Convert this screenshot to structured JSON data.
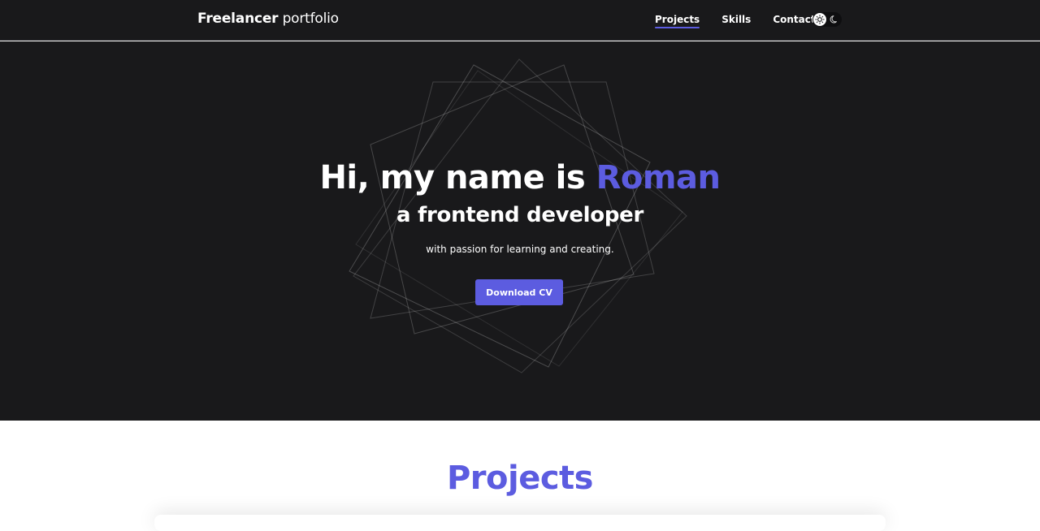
{
  "header": {
    "logo_bold": "Freelancer",
    "logo_light": " portfolio",
    "nav": [
      {
        "label": "Projects",
        "active": true
      },
      {
        "label": "Skills",
        "active": false
      },
      {
        "label": "Contacts",
        "active": false
      }
    ],
    "theme_toggle": {
      "icons": [
        "sun-icon",
        "moon-icon"
      ],
      "mode": "dark"
    }
  },
  "hero": {
    "greeting": "Hi, my name is ",
    "name": "Roman",
    "subtitle": "a frontend developer",
    "tagline": "with passion for learning and creating.",
    "cta_label": "Download CV"
  },
  "projects": {
    "title": "Projects"
  },
  "colors": {
    "accent": "#5c5ce0",
    "dark_bg": "#19191b",
    "light_bg": "#ffffff",
    "text_on_dark": "#ffffff"
  }
}
